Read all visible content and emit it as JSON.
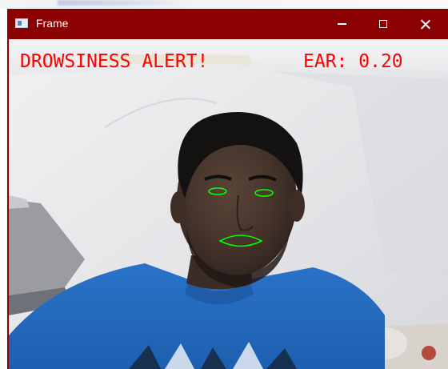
{
  "window": {
    "title": "Frame",
    "icons": {
      "app": "app-window-icon",
      "minimize": "minimize-icon",
      "maximize": "maximize-icon",
      "close": "close-icon"
    },
    "colors": {
      "titlebar": "#8b0000",
      "title_text": "#ffffff"
    }
  },
  "frame": {
    "alert_text": "DROWSINESS ALERT!",
    "ear_label": "EAR:",
    "ear_value": "0.20",
    "overlay_color": "#ff0000",
    "contour_color": "#00ff00",
    "contours": [
      "left-eye-contour",
      "right-eye-contour",
      "mouth-contour"
    ]
  }
}
